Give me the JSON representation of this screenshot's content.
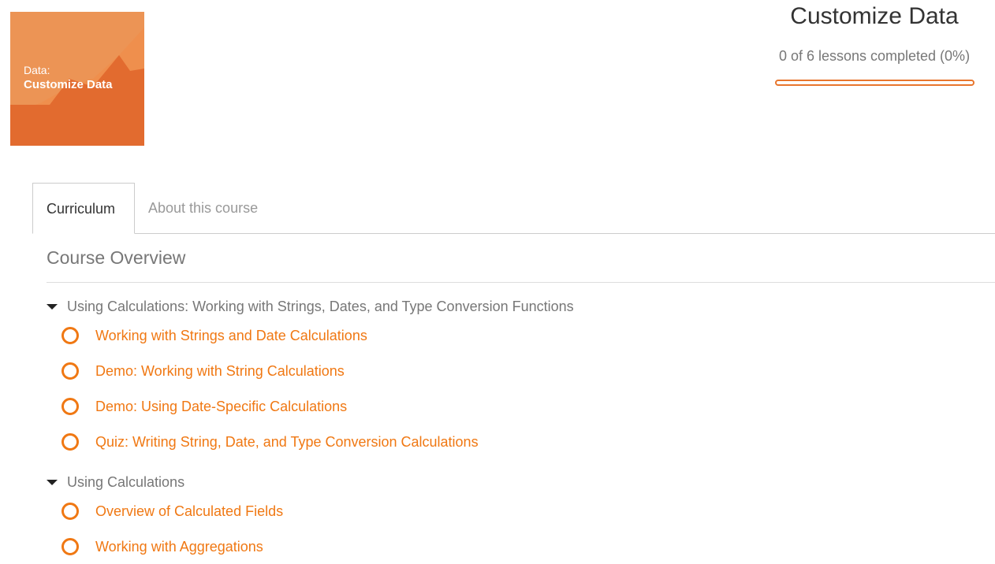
{
  "thumbnail": {
    "line1": "Data:",
    "line2": "Customize Data",
    "colors": {
      "background": "#ec9455",
      "mountain_light": "#ef8f4d",
      "mountain_dark": "#e0692f"
    }
  },
  "header": {
    "title": "Customize Data",
    "progress_text": "0 of 6 lessons completed (0%)",
    "progress_fraction": 0.0
  },
  "tabs": [
    {
      "label": "Curriculum",
      "active": true
    },
    {
      "label": "About this course",
      "active": false
    }
  ],
  "overview_title": "Course Overview",
  "sections": [
    {
      "title": "Using Calculations: Working with Strings, Dates, and Type Conversion Functions",
      "lessons": [
        "Working with Strings and Date Calculations",
        "Demo: Working with String Calculations",
        "Demo: Using Date-Specific Calculations",
        "Quiz: Writing String, Date, and Type Conversion Calculations"
      ]
    },
    {
      "title": "Using Calculations",
      "lessons": [
        "Overview of Calculated Fields",
        "Working with Aggregations"
      ]
    }
  ],
  "colors": {
    "accent": "#f07813",
    "muted_text": "#777777"
  },
  "icons": {
    "section_toggle": "caret-down-icon",
    "lesson_status": "incomplete-circle-icon"
  }
}
